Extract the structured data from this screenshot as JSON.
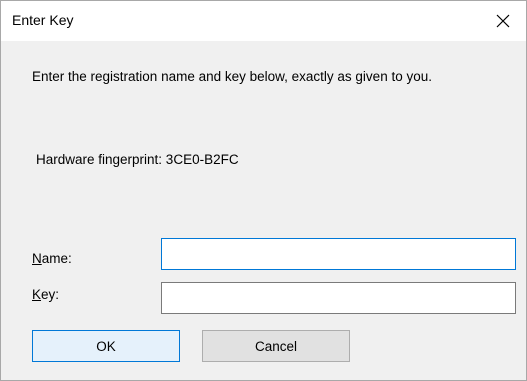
{
  "window": {
    "title": "Enter Key",
    "close_icon": "close-icon"
  },
  "dialog": {
    "message": "Enter the registration name and key below, exactly as given to you.",
    "hardware_fingerprint": "Hardware fingerprint: 3CE0-B2FC",
    "name_label": {
      "accel": "N",
      "rest": "ame:"
    },
    "key_label": {
      "accel": "K",
      "rest": "ey:"
    },
    "name_value": "",
    "key_value": ""
  },
  "buttons": {
    "ok": "OK",
    "cancel": "Cancel"
  },
  "colors": {
    "accent": "#0078d7",
    "titlebar": "#ffffff",
    "background": "#f0f0f0"
  }
}
